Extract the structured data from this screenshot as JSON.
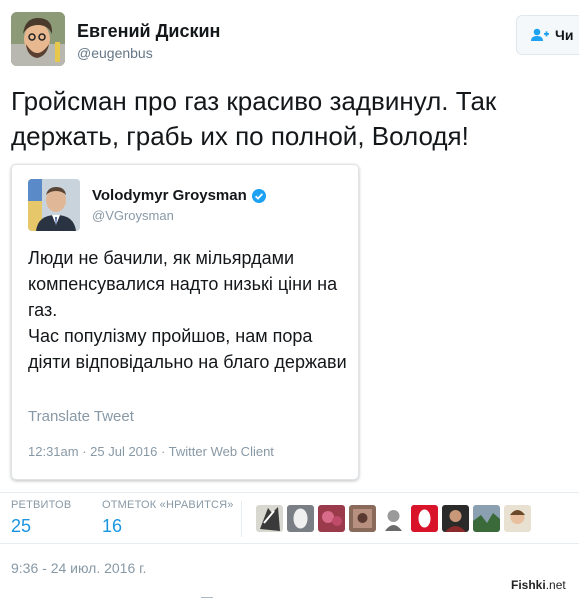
{
  "author": {
    "name": "Евгений Дискин",
    "handle": "@eugenbus",
    "avatar_icon": "avatar-cartoon-icon"
  },
  "follow_button": {
    "label": "Чи",
    "icon": "add-user-icon"
  },
  "tweet": {
    "text": "Гройсман про газ красиво задвинул. Так держать, грабь их по полной, Володя!"
  },
  "quoted_tweet": {
    "name": "Volodymyr Groysman",
    "verified_icon": "verified-badge-icon",
    "handle": "@VGroysman",
    "text_lines": [
      "Люди не бачили, як мільярдами компенсувалися надто низькі ціни на газ.",
      "Час популізму пройшов, нам пора діяти відповідально на благо держави"
    ],
    "translate_label": "Translate Tweet",
    "meta": "12:31am · 25 Jul 2016 · Twitter Web Client"
  },
  "stats": {
    "retweets_caption": "РЕТВИТОВ",
    "retweets_count": "25",
    "likes_caption": "ОТМЕТОК «НРАВИТСЯ»",
    "likes_count": "16"
  },
  "timestamp": "9:36 - 24 июл. 2016 г.",
  "watermark": {
    "brand": "Fishki",
    "suffix": ".net"
  },
  "colors": {
    "link": "#1b95e0",
    "muted": "#8899a6",
    "verified": "#1da1f2"
  }
}
